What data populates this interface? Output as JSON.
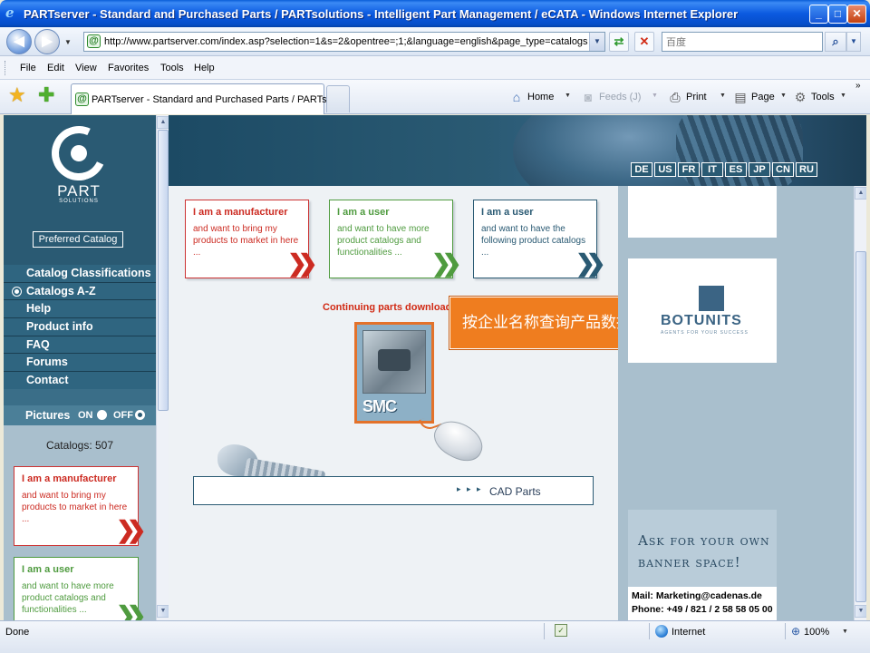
{
  "window": {
    "title": "PARTserver - Standard and Purchased Parts / PARTsolutions - Intelligent Part Management / eCATA - Windows Internet Explorer",
    "minimize": "_",
    "maximize": "□",
    "close": "✕"
  },
  "address_bar": {
    "url": "http://www.partserver.com/index.asp?selection=1&s=2&opentree=;1;&language=english&page_type=catalogs",
    "search_placeholder": "百度"
  },
  "menubar": {
    "items": [
      "File",
      "Edit",
      "View",
      "Favorites",
      "Tools",
      "Help"
    ]
  },
  "tab": {
    "title": "PARTserver - Standard and Purchased Parts / PARTs..."
  },
  "command_bar": {
    "home": "Home",
    "feeds": "Feeds (J)",
    "print": "Print",
    "page": "Page",
    "tools": "Tools"
  },
  "sidebar": {
    "logo_text": "PART",
    "logo_sub": "SOLUTIONS",
    "preferred_catalog": "Preferred Catalog",
    "nav": [
      {
        "label": "Catalog Classifications"
      },
      {
        "label": "Catalogs A-Z"
      },
      {
        "label": "Help"
      },
      {
        "label": "Product info"
      },
      {
        "label": "FAQ"
      },
      {
        "label": "Forums"
      },
      {
        "label": "Contact"
      }
    ],
    "pictures_label": "Pictures",
    "pictures_on": "ON",
    "pictures_off": "OFF",
    "catalog_count": "Catalogs: 507",
    "card_manufacturer": {
      "title": "I am a manufacturer",
      "text": "and want to bring my products to market in here ..."
    },
    "card_user": {
      "title": "I am a user",
      "text": "and want to have more product catalogs and functionalities ..."
    }
  },
  "main": {
    "languages": [
      "DE",
      "US",
      "FR",
      "IT",
      "ES",
      "JP",
      "CN",
      "RU"
    ],
    "cards": [
      {
        "title": "I am a manufacturer",
        "text": "and want to bring my products to market in here ..."
      },
      {
        "title": "I am a user",
        "text": "and want to have more product catalogs and functionalities ..."
      },
      {
        "title": "I am a user",
        "text": "and want to have the following product catalogs ..."
      }
    ],
    "continuing_text": "Continuing parts download ...",
    "smc_logo": "SMC",
    "tooltip": "按企业名称查询产品数据",
    "cad_parts": "CAD Parts",
    "cad_arrows": "▸ ▸ ▸"
  },
  "right_ads": {
    "brand": "BOTUNITS",
    "tagline": "AGENTS FOR YOUR SUCCESS",
    "banner_head": "Ask for your own banner space!",
    "mail": "Mail: Marketing@cadenas.de",
    "phone": "Phone: +49 / 821 / 2 58 58 05 00"
  },
  "statusbar": {
    "status": "Done",
    "zone": "Internet",
    "zoom": "100%"
  },
  "icons": [
    "ie-logo-icon",
    "back-icon",
    "forward-icon",
    "refresh-icon",
    "stop-icon",
    "search-icon",
    "favorites-star-icon",
    "add-favorites-icon",
    "home-icon",
    "feeds-icon",
    "print-icon",
    "page-icon",
    "tools-gear-icon",
    "globe-icon",
    "zoom-icon"
  ]
}
